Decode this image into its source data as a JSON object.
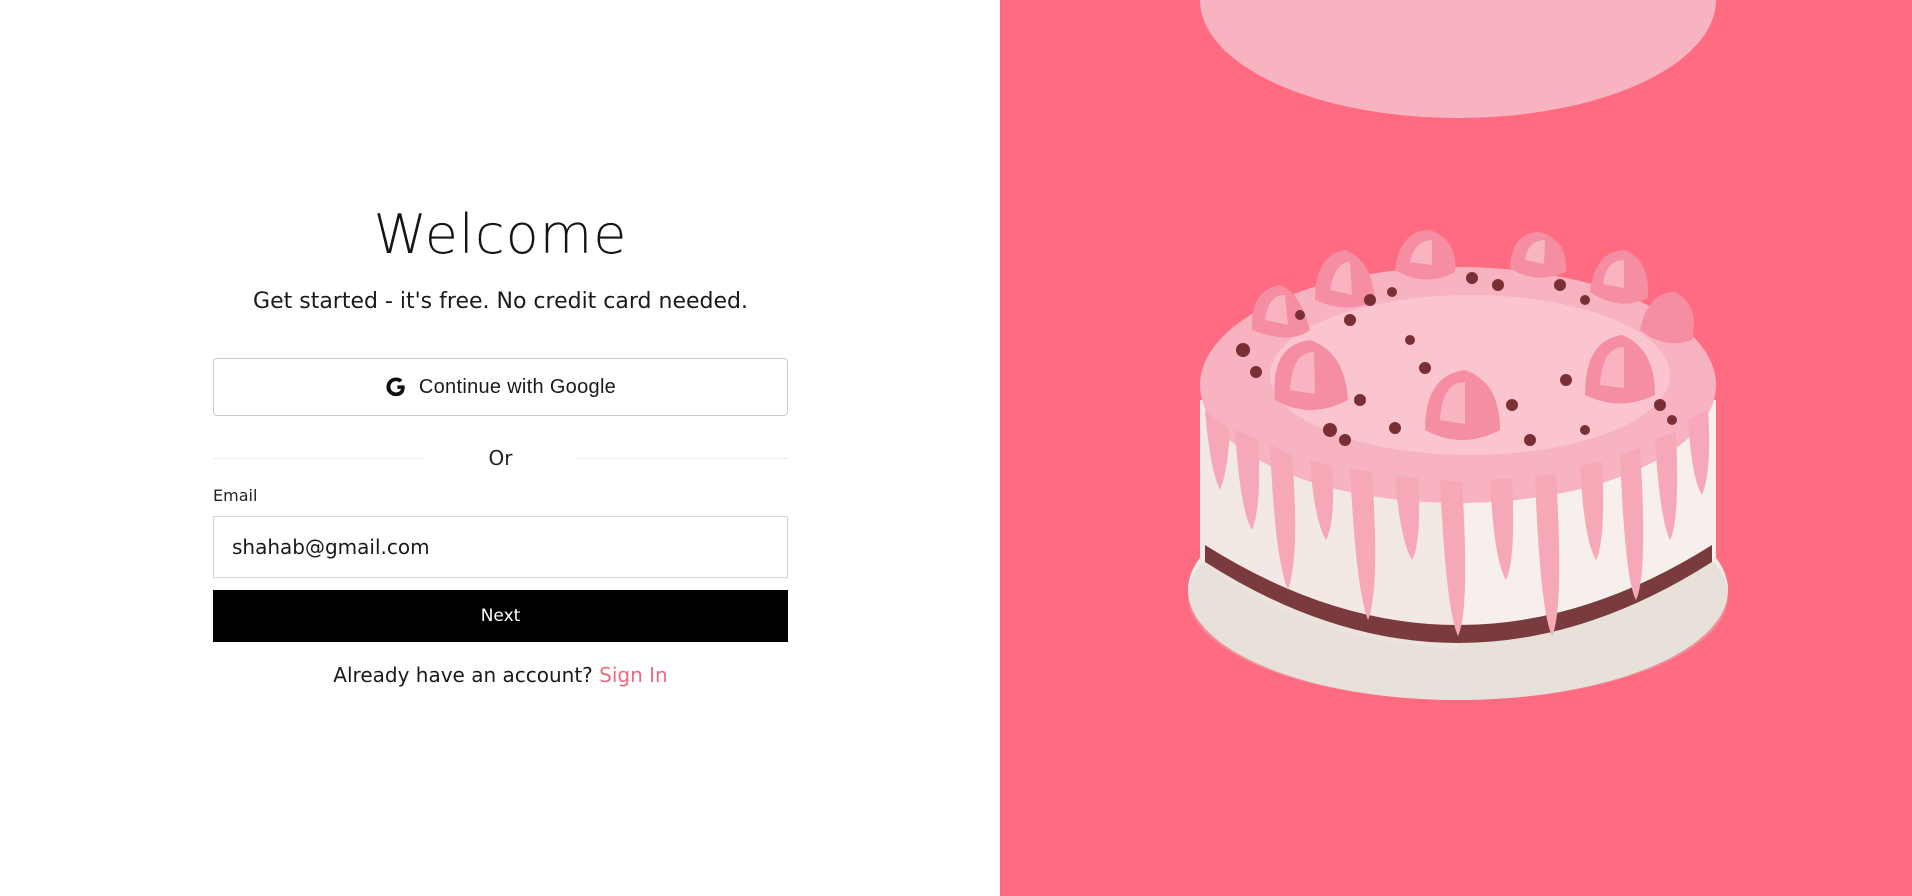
{
  "auth": {
    "title": "Welcome",
    "subtitle": "Get started - it's free. No credit card needed.",
    "google_button_label": "Continue with Google",
    "divider_text": "Or",
    "email_label": "Email",
    "email_value": "shahab@gmail.com",
    "next_button_label": "Next",
    "account_prompt": "Already have an account?",
    "signin_link_label": "Sign In"
  },
  "icons": {
    "google": "google-g-icon",
    "hero": "cake-illustration"
  },
  "colors": {
    "hero_background": "#ff6b81",
    "accent_link": "#ec6a80",
    "primary_button": "#000000"
  }
}
